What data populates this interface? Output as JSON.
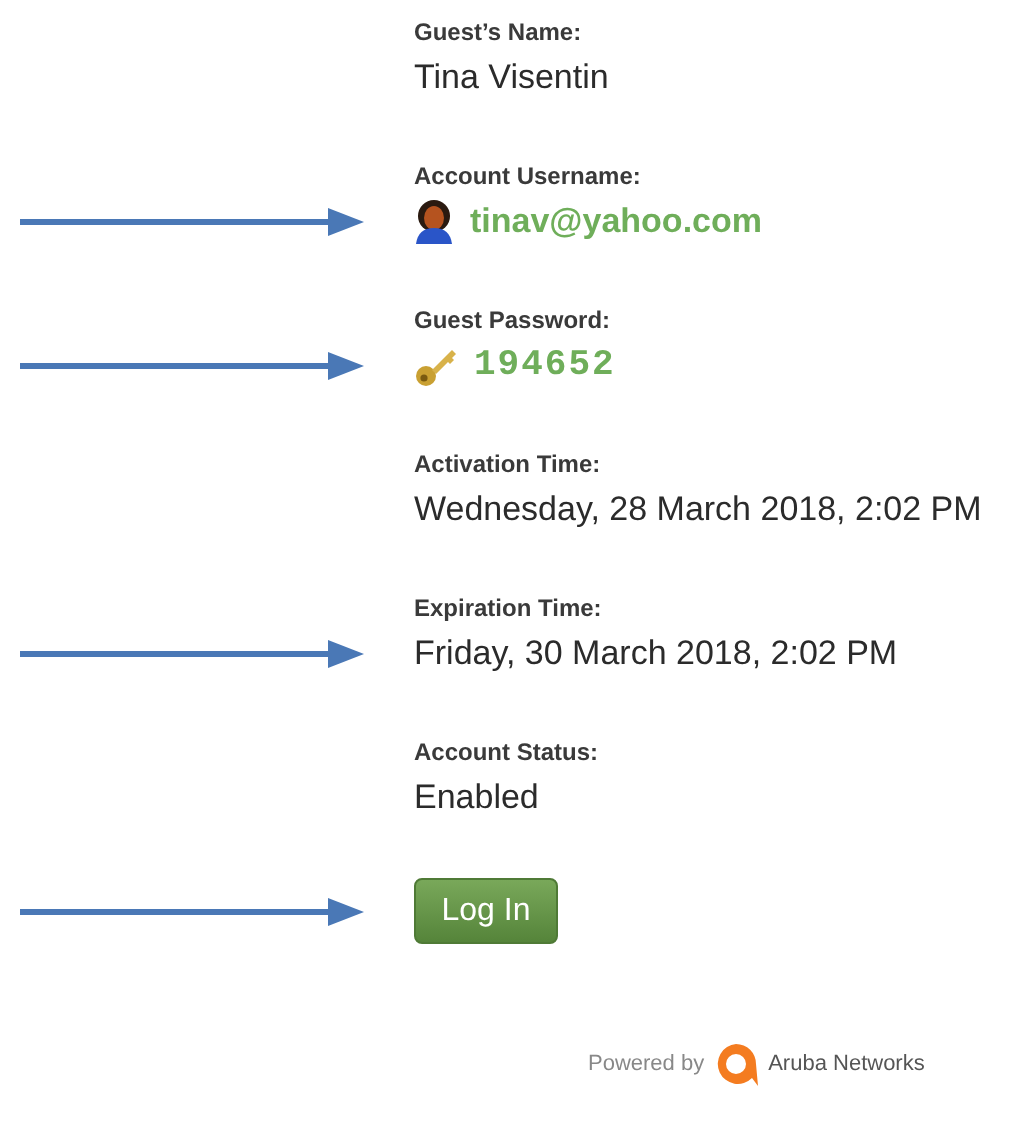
{
  "fields": [
    {
      "label": "Guest’s Name:",
      "value": "Tina Visentin",
      "kind": "plain",
      "arrow": false
    },
    {
      "label": "Account Username:",
      "value": "tinav@yahoo.com",
      "kind": "username",
      "arrow": true
    },
    {
      "label": "Guest Password:",
      "value": "194652",
      "kind": "password",
      "arrow": true
    },
    {
      "label": "Activation Time:",
      "value": "Wednesday, 28 March 2018, 2:02 PM",
      "kind": "plain",
      "arrow": false
    },
    {
      "label": "Expiration Time:",
      "value": "Friday, 30 March 2018, 2:02 PM",
      "kind": "plain",
      "arrow": true
    },
    {
      "label": "Account Status:",
      "value": "Enabled",
      "kind": "plain",
      "arrow": false
    }
  ],
  "login_button": {
    "label": "Log In",
    "arrow": true
  },
  "footer": {
    "prefix": "Powered by",
    "brand": "Aruba Networks"
  }
}
